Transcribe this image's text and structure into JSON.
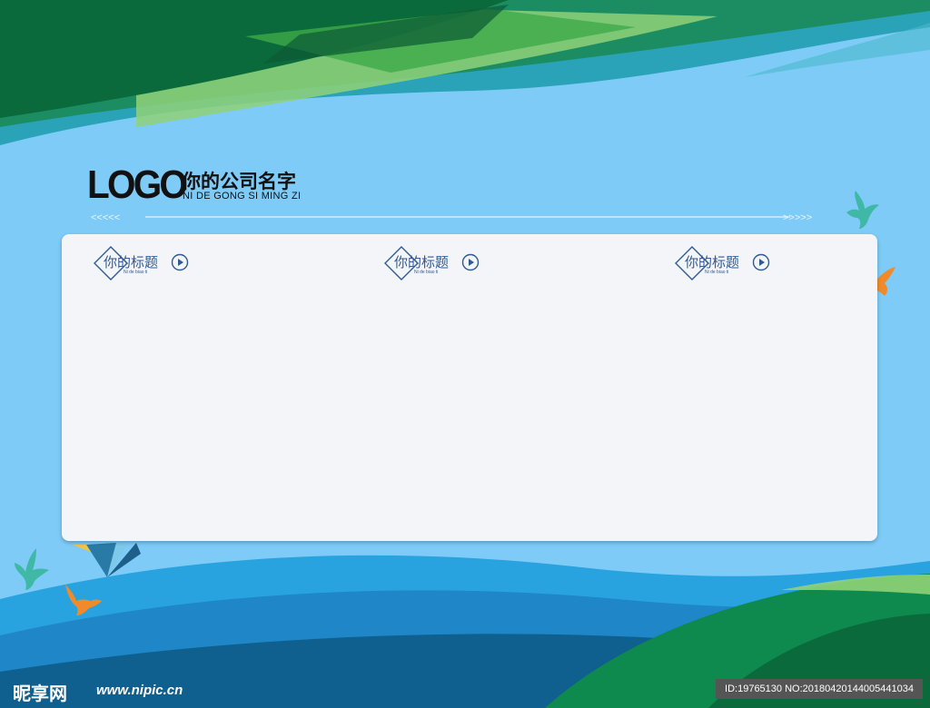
{
  "header": {
    "logo_text": "LOGO",
    "company_name_cn": "你的公司名字",
    "company_name_pinyin": "NI DE GONG SI MING ZI",
    "left_arrows": "<<<<<",
    "right_arrows": ">>>>>"
  },
  "panel": {
    "titles": [
      {
        "label": "你的标题",
        "pinyin": "Ni de biao ti"
      },
      {
        "label": "你的标题",
        "pinyin": "Ni de biao ti"
      },
      {
        "label": "你的标题",
        "pinyin": "Ni de biao ti"
      }
    ]
  },
  "footer": {
    "brand": "昵享网",
    "url": "www.nipic.cn",
    "id_text": "ID:19765130 NO:20180420144005441034"
  },
  "colors": {
    "sky": "#7ecbf7",
    "dark_green": "#0b6a3b",
    "green": "#3daa4a",
    "light_green": "#8fd178",
    "teal": "#2a9db8",
    "blue": "#1f86c7",
    "title_blue": "#2f5a95"
  },
  "icons": [
    "dove-icon",
    "play-circle-icon",
    "diamond-frame-icon"
  ]
}
